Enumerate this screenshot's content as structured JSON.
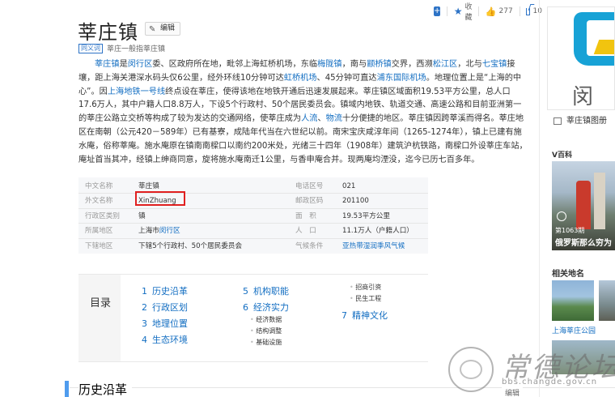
{
  "actions": {
    "collect": "收藏",
    "likes": "277",
    "shares": "10"
  },
  "title": "莘庄镇",
  "edit_label": "编辑",
  "polysemy": {
    "tag": "同义词",
    "text": "莘庄一般指莘庄镇"
  },
  "intro": [
    {
      "t": "莘庄镇",
      "link": true
    },
    {
      "t": "是"
    },
    {
      "t": "闵行区",
      "link": true
    },
    {
      "t": "委、区政府所在地，毗邻上海虹桥机场，东临"
    },
    {
      "t": "梅陇镇",
      "link": true
    },
    {
      "t": "，南与"
    },
    {
      "t": "颛桥镇",
      "link": true
    },
    {
      "t": "交界，西濒"
    },
    {
      "t": "松江区",
      "link": true
    },
    {
      "t": "，北与"
    },
    {
      "t": "七宝镇",
      "link": true
    },
    {
      "t": "接壤，距上海关港深水码头仅6公里，经外环线10分钟可达"
    },
    {
      "t": "虹桥机场",
      "link": true
    },
    {
      "t": "、45分钟可直达"
    },
    {
      "t": "浦东国际机场",
      "link": true
    },
    {
      "t": "。地理位置上是“上海的中心”。因"
    },
    {
      "t": "上海地铁一号线",
      "link": true
    },
    {
      "t": "终点设在莘庄，使得该地在地铁开通后迅速发展起来。莘庄镇区域面积19.53平方公里，总人口17.6万人，其中户籍人口8.8万人，下设5个行政村、50个居民委员会。镇域内地铁、轨道交通、高速公路和目前亚洲第一的莘庄公路立交桥等构成了较为发达的交通网络，使莘庄成为"
    },
    {
      "t": "人流",
      "link": true
    },
    {
      "t": "、"
    },
    {
      "t": "物流",
      "link": true
    },
    {
      "t": "十分便捷的地区。莘庄镇因跨莘溪而得名。莘庄地区在南朝（公元420－589年）已有基寮，成陆年代当在六世纪以前。南宋宝庆咸淳年间（1265-1274年），镇上已建有施水庵，俗称莘庵。施水庵原在镇南南樑口以南约200米处，光绪三十四年（1908年）建筑沪杭铁路，南樑口外设莘庄车站，庵址首当其冲，经镇上绅商同意，旋将施水庵南迁1公里，与香申庵合并。现两庵均湮没，迄今已历七百多年。"
    }
  ],
  "basic_info": [
    {
      "k1": "中文名称",
      "v1": "莘庄镇",
      "k2": "电话区号",
      "v2": "021"
    },
    {
      "k1": "外文名称",
      "v1": "XinZhuang",
      "k2": "邮政区码",
      "v2": "201100"
    },
    {
      "k1": "行政区类别",
      "v1": "镇",
      "k2": "面　积",
      "v2": "19.53平方公里"
    },
    {
      "k1": "所属地区",
      "v1": "上海市",
      "v1_link": "闵行区",
      "k2": "人　口",
      "v2": "11.1万人（户籍人口）"
    },
    {
      "k1": "下辖地区",
      "v1": "下辖5个行政村、50个居民委员会",
      "k2": "气候条件",
      "v2": "亚热带湿润季风气候",
      "v2_link": true
    }
  ],
  "catalog": {
    "title": "目录",
    "col1": [
      {
        "n": "1",
        "t": "历史沿革"
      },
      {
        "n": "2",
        "t": "行政区划"
      },
      {
        "n": "3",
        "t": "地理位置"
      },
      {
        "n": "4",
        "t": "生态环境"
      }
    ],
    "col2": [
      {
        "n": "5",
        "t": "机构职能"
      },
      {
        "n": "6",
        "t": "经济实力"
      }
    ],
    "col2_sub": [
      "经济数据",
      "结构调整",
      "基础设施"
    ],
    "col3_sub": [
      "招商引资",
      "民生工程"
    ],
    "col3": [
      {
        "n": "7",
        "t": "精神文化"
      }
    ]
  },
  "section": {
    "title": "历史沿革",
    "edit": "编辑"
  },
  "sidebar": {
    "logo_text": "闵行",
    "album": "莘庄镇图册",
    "vbaike": "V百科",
    "vb_count": "第1063期",
    "vb_caption": "俄罗斯那么穷为",
    "related_title": "相关地名",
    "related_label": "上海莘庄公园"
  },
  "watermark": {
    "text": "常德论坛",
    "url": "bbs.changde.gov.cn"
  }
}
